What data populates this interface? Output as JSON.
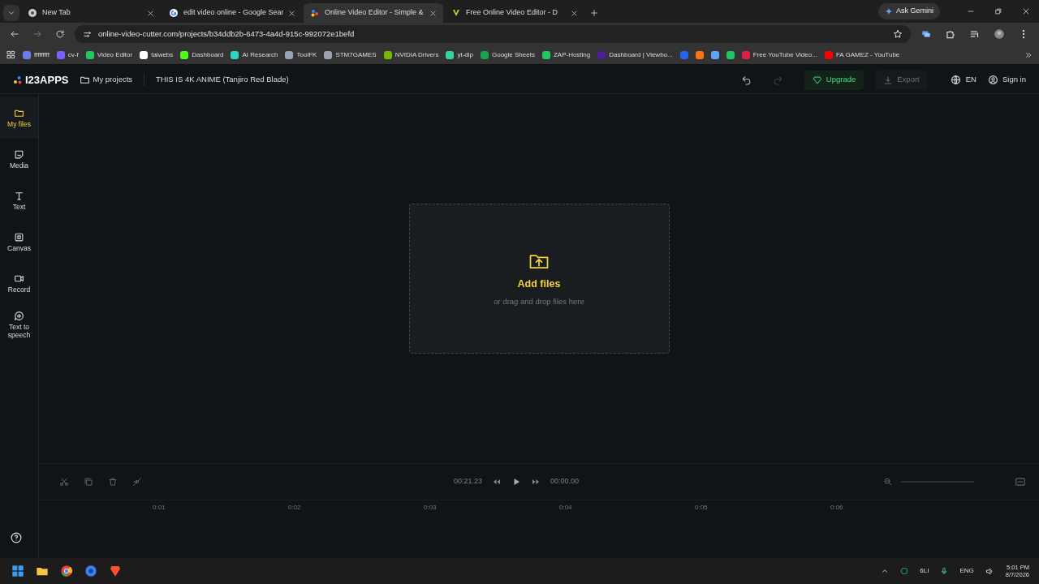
{
  "browser": {
    "tabs": [
      {
        "title": "New Tab",
        "selected": false
      },
      {
        "title": "edit video online - Google Sear",
        "selected": false
      },
      {
        "title": "Online Video Editor - Simple &",
        "selected": true
      },
      {
        "title": "Free Online Video Editor - D",
        "selected": false
      }
    ],
    "ask_button": "Ask Gemini",
    "url": "online-video-cutter.com/projects/b34ddb2b-6473-4a4d-915c-992072e1befd",
    "bookmarks": [
      {
        "label": "fffffffff",
        "color": "#6c7cf0"
      },
      {
        "label": "cv-f",
        "color": "#7b61ff"
      },
      {
        "label": "Video Editor",
        "color": "#22c55e"
      },
      {
        "label": "taiwebs",
        "color": "#ffffff"
      },
      {
        "label": "Dashboard",
        "color": "#53fc18"
      },
      {
        "label": "AI Research",
        "color": "#2dd4bf"
      },
      {
        "label": "ToolFK",
        "color": "#94a3b8"
      },
      {
        "label": "STM7GAMES",
        "color": "#9ca3af"
      },
      {
        "label": "NVIDIA Drivers",
        "color": "#76b900"
      },
      {
        "label": "yt-dlp",
        "color": "#34d399"
      },
      {
        "label": "Google Sheets",
        "color": "#16a34a"
      },
      {
        "label": "ZAP-Hosting",
        "color": "#22c55e"
      },
      {
        "label": "Dashboard | Viewbo...",
        "color": "#4c1d95"
      },
      {
        "color": "#2563eb"
      },
      {
        "color": "#f97316"
      },
      {
        "color": "#60a5fa"
      },
      {
        "color": "#22c55e"
      },
      {
        "label": "Free YouTube Video...",
        "color": "#e11d48"
      },
      {
        "label": "FA GAMEZ - YouTube",
        "color": "#ff0000"
      }
    ]
  },
  "app": {
    "logo": "I23APPS",
    "projects_link": "My projects",
    "project_title": "THIS IS 4K ANIME (Tanjiro Red Blade)",
    "upgrade": "Upgrade",
    "export": {
      "label": "Export",
      "disabled": true
    },
    "language": "EN",
    "sign_in": "Sign in",
    "sidebar": [
      {
        "label": "My files",
        "selected": true
      },
      {
        "label": "Media",
        "selected": false
      },
      {
        "label": "Text",
        "selected": false
      },
      {
        "label": "Canvas",
        "selected": false
      },
      {
        "label": "Record",
        "selected": false
      },
      {
        "label": "Text to speech",
        "selected": false
      }
    ],
    "dropzone": {
      "title": "Add files",
      "subtitle": "or drag and drop files here"
    },
    "timeline": {
      "duration": "00:21.23",
      "position": "00:00.00",
      "ticks": [
        "0:01",
        "0:02",
        "0:03",
        "0:04",
        "0:05",
        "0:06"
      ]
    }
  },
  "taskbar": {
    "weather": "6LI",
    "language": "ENG",
    "time": "5:01 PM",
    "date": "8/7/2026"
  }
}
